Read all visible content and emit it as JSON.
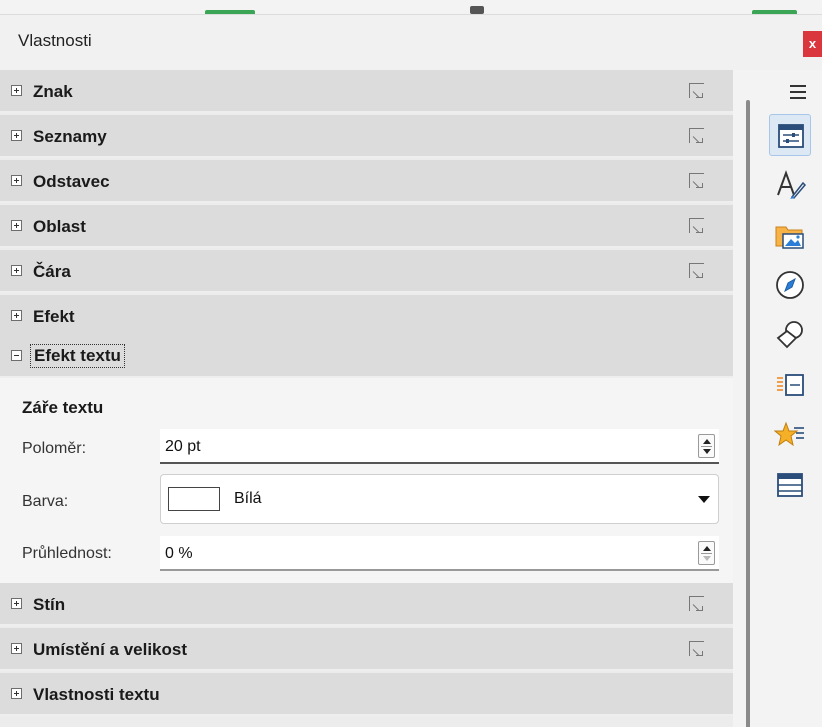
{
  "window": {
    "title": "Vlastnosti",
    "close_label": "x"
  },
  "sections": [
    {
      "label": "Znak",
      "expanded": false,
      "has_more": true
    },
    {
      "label": "Seznamy",
      "expanded": false,
      "has_more": true
    },
    {
      "label": "Odstavec",
      "expanded": false,
      "has_more": true
    },
    {
      "label": "Oblast",
      "expanded": false,
      "has_more": true
    },
    {
      "label": "Čára",
      "expanded": false,
      "has_more": true
    },
    {
      "label": "Efekt",
      "expanded": false,
      "has_more": false
    },
    {
      "label": "Efekt textu",
      "expanded": true,
      "has_more": false
    },
    {
      "label": "Stín",
      "expanded": false,
      "has_more": true
    },
    {
      "label": "Umístění a velikost",
      "expanded": false,
      "has_more": true
    },
    {
      "label": "Vlastnosti textu",
      "expanded": false,
      "has_more": false
    }
  ],
  "text_effect": {
    "heading": "Záře textu",
    "radius": {
      "label": "Poloměr:",
      "value": "20 pt"
    },
    "color": {
      "label": "Barva:",
      "value": "Bílá",
      "swatch": "#ffffff"
    },
    "transparency": {
      "label": "Průhlednost:",
      "value": "0 %"
    }
  },
  "sidebar": {
    "menu_icon": "hamburger-menu-icon",
    "tabs": [
      {
        "icon": "properties-icon",
        "active": true
      },
      {
        "icon": "styles-icon",
        "active": false
      },
      {
        "icon": "gallery-icon",
        "active": false
      },
      {
        "icon": "navigator-icon",
        "active": false
      },
      {
        "icon": "shapes-icon",
        "active": false
      },
      {
        "icon": "slide-transition-icon",
        "active": false
      },
      {
        "icon": "animation-icon",
        "active": false
      },
      {
        "icon": "master-slides-icon",
        "active": false
      }
    ]
  },
  "colors": {
    "section_header": "#dcdcdc",
    "close_button": "#d9363e",
    "active_tab": "#dde8f5"
  }
}
